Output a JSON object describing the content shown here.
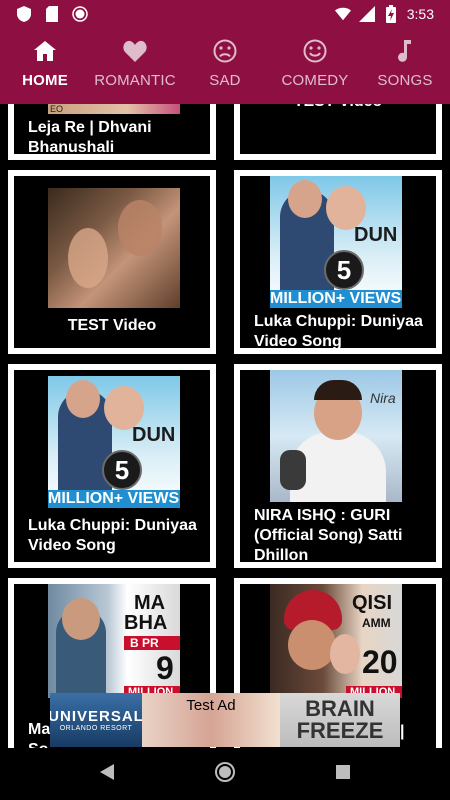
{
  "status_bar": {
    "time": "3:53"
  },
  "tabs": [
    {
      "label": "HOME",
      "icon": "home-icon",
      "active": true
    },
    {
      "label": "ROMANTIC",
      "icon": "heart-icon",
      "active": false
    },
    {
      "label": "SAD",
      "icon": "sad-face-icon",
      "active": false
    },
    {
      "label": "COMEDY",
      "icon": "smile-face-icon",
      "active": false
    },
    {
      "label": "SONGS",
      "icon": "music-note-icon",
      "active": false
    }
  ],
  "videos": [
    {
      "title_line1": "Leja Re | Dhvani",
      "title_line2": "Bhanushali"
    },
    {
      "title_line1": "TEST Video"
    },
    {
      "title_line1": "TEST Video"
    },
    {
      "title_line1": "Luka Chuppi: Duniyaa",
      "title_line2": "Video Song",
      "thumb_text": "DUN",
      "badge": "5",
      "banner": "MILLION+ VIEWS"
    },
    {
      "title_line1": "Luka Chuppi: Duniyaa",
      "title_line2": "Video Song",
      "thumb_text": "DUN",
      "badge": "5",
      "banner": "MILLION+ VIEWS"
    },
    {
      "title_line1": "NIRA ISHQ : GURI",
      "title_line2": "(Official Song) Satti",
      "title_line3": "Dhillon",
      "thumb_text": "Nira"
    },
    {
      "title_line1": "Ma",
      "title_line2": "So",
      "thumb_text1": "MA",
      "thumb_text2": "BHA",
      "thumb_text3": "B PR",
      "thumb_text4": "9",
      "thumb_text5": "MILLION"
    },
    {
      "title_line1": "|",
      "thumb_text1": "QISI",
      "thumb_text2": "AMM",
      "thumb_text3": "20",
      "thumb_text4": "MILLION"
    }
  ],
  "ad": {
    "label": "Test Ad",
    "brand_line1": "UNIVERSAL",
    "brand_line2": "ORLANDO RESORT",
    "headline_line1": "BRAIN",
    "headline_line2": "FREEZE"
  },
  "colors": {
    "primary": "#8e1043",
    "card": "#ffffff",
    "background": "#000000"
  }
}
